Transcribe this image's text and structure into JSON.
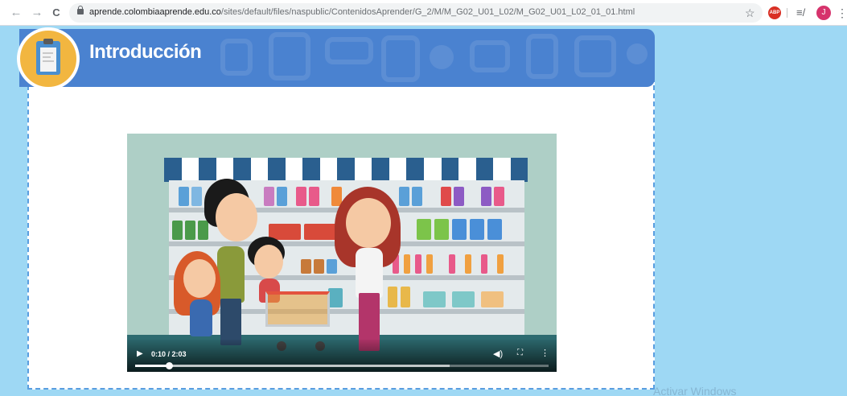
{
  "browser": {
    "back_glyph": "←",
    "forward_glyph": "→",
    "reload_glyph": "C",
    "url_host": "aprende.colombiaaprende.edu.co",
    "url_path": "/sites/default/files/naspublic/ContenidosAprender/G_2/M/M_G02_U01_L02/M_G02_U01_L02_01_01.html",
    "bookmark_glyph": "☆",
    "extension_label": "ABP",
    "queue_glyph": "≡/",
    "profile_initial": "J",
    "menu_glyph": "⋮"
  },
  "banner": {
    "title": "Introducción",
    "color": "#4a82d0",
    "icon": "clipboard-icon"
  },
  "video": {
    "play_glyph": "▶",
    "time_display": "0:10 / 2:03",
    "progress": 0.081,
    "buffered": 0.76,
    "volume_glyph": "◀)",
    "fullscreen_glyph": "⛶",
    "more_glyph": "⋮"
  },
  "watermark": "Activar Windows"
}
